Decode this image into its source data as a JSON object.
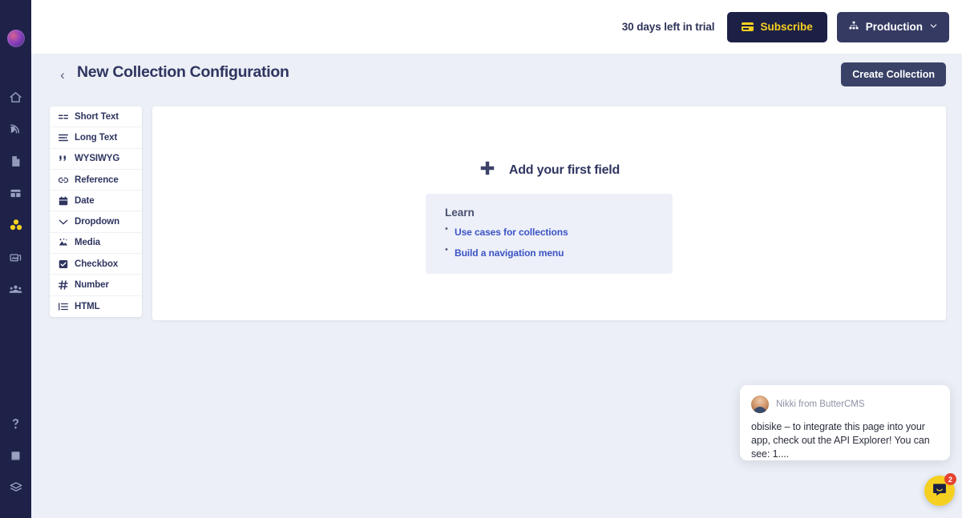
{
  "rail": {
    "logo_name": "buttercms-avatar-logo",
    "items": [
      {
        "name": "home-icon",
        "label": "Home",
        "active": false
      },
      {
        "name": "blog-icon",
        "label": "Blog",
        "active": false
      },
      {
        "name": "pages-icon",
        "label": "Pages",
        "active": false
      },
      {
        "name": "components-icon",
        "label": "Components",
        "active": false
      },
      {
        "name": "collections-icon",
        "label": "Collections",
        "active": true
      },
      {
        "name": "media-icon",
        "label": "Media",
        "active": false
      },
      {
        "name": "team-icon",
        "label": "Team",
        "active": false
      }
    ],
    "bottom_items": [
      {
        "name": "help-icon",
        "label": "Help",
        "active": false
      },
      {
        "name": "docs-icon",
        "label": "Docs",
        "active": false
      },
      {
        "name": "layers-icon",
        "label": "Stack",
        "active": false
      }
    ]
  },
  "topbar": {
    "trial_text": "30 days left in trial",
    "subscribe_label": "Subscribe",
    "environment_label": "Production"
  },
  "header": {
    "back_glyph": "‹",
    "title": "New Collection Configuration",
    "create_collection_label": "Create Collection"
  },
  "field_types": [
    {
      "label": "Short Text",
      "icon": "short-text-icon"
    },
    {
      "label": "Long Text",
      "icon": "long-text-icon"
    },
    {
      "label": "WYSIWYG",
      "icon": "quote-icon"
    },
    {
      "label": "Reference",
      "icon": "link-icon"
    },
    {
      "label": "Date",
      "icon": "calendar-icon"
    },
    {
      "label": "Dropdown",
      "icon": "chevron-down-icon"
    },
    {
      "label": "Media",
      "icon": "image-icon"
    },
    {
      "label": "Checkbox",
      "icon": "checkbox-icon"
    },
    {
      "label": "Number",
      "icon": "hash-icon"
    },
    {
      "label": "HTML",
      "icon": "list-icon"
    }
  ],
  "main": {
    "add_field_label": "Add your first field",
    "learn": {
      "title": "Learn",
      "links": [
        "Use cases for collections",
        "Build a navigation menu"
      ]
    }
  },
  "intercom": {
    "sender": "Nikki from ButterCMS",
    "message": "obisike – to integrate this page into your app, check out the API Explorer! You can see: 1....",
    "badge_count": "2"
  },
  "colors": {
    "rail_bg": "#1e2249",
    "accent_yellow": "#f6d020",
    "dark_navy": "#1c2045",
    "link_blue": "#3b53c4",
    "page_bg": "#eceff6",
    "badge_red": "#e5432f"
  }
}
